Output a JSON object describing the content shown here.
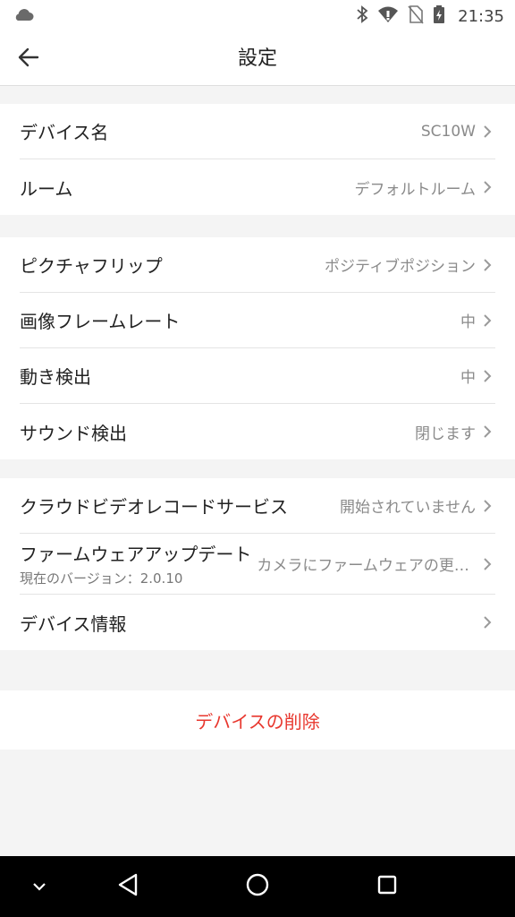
{
  "status_bar": {
    "time": "21:35",
    "icons": [
      "cloud-icon",
      "bluetooth-icon",
      "wifi-icon",
      "no-sim-icon",
      "battery-charging-icon"
    ]
  },
  "header": {
    "title": "設定",
    "back_icon": "arrow-left-icon"
  },
  "group1": {
    "items": [
      {
        "label": "デバイス名",
        "value": "SC10W"
      },
      {
        "label": "ルーム",
        "value": "デフォルトルーム"
      }
    ]
  },
  "group2": {
    "items": [
      {
        "label": "ピクチャフリップ",
        "value": "ポジティブポジション"
      },
      {
        "label": "画像フレームレート",
        "value": "中"
      },
      {
        "label": "動き検出",
        "value": "中"
      },
      {
        "label": "サウンド検出",
        "value": "閉じます"
      }
    ]
  },
  "group3": {
    "items": [
      {
        "label": "クラウドビデオレコードサービス",
        "value": "開始されていません"
      },
      {
        "label": "ファームウェアアップデート",
        "sublabel": "現在のバージョン：2.0.10",
        "value": "カメラにファームウェアの更新はありません"
      },
      {
        "label": "デバイス情報",
        "value": ""
      }
    ]
  },
  "delete": {
    "label": "デバイスの削除",
    "color": "#e8372e"
  },
  "nav_bar": {
    "icons": [
      "chevron-down-icon",
      "back-triangle-icon",
      "home-circle-icon",
      "recents-square-icon"
    ]
  }
}
